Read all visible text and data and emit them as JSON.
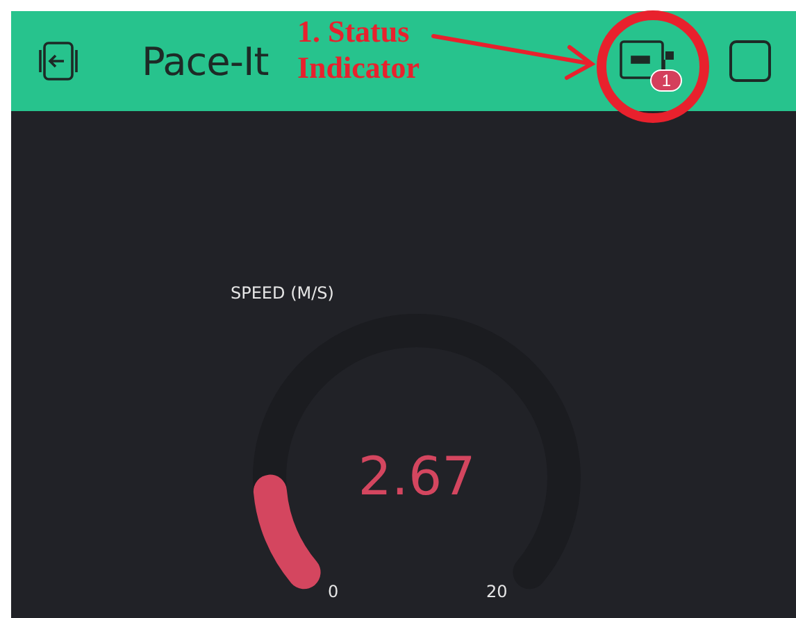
{
  "header": {
    "title": "Pace-It",
    "status_badge": "1"
  },
  "annotation": {
    "lines": [
      "1. Status",
      "Indicator"
    ]
  },
  "gauge": {
    "label": "SPEED (M/S)",
    "value": "2.67",
    "min": "0",
    "max": "20",
    "level": 0.1335
  }
}
